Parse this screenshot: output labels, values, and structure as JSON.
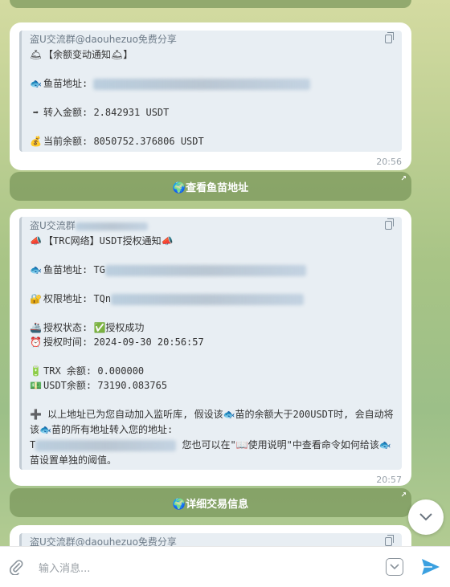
{
  "messages": [
    {
      "header": "盗U交流群@daouhezuo免费分享",
      "lines": [
        {
          "emoji": "🛎",
          "text": "【余额变动通知🛎】"
        },
        {
          "emoji": "🐟",
          "text": "鱼苗地址: "
        },
        {
          "emoji": "➡",
          "text": "转入金额: 2.842931 USDT"
        },
        {
          "emoji": "💰",
          "text": "当前余额: 8050752.376806 USDT"
        }
      ],
      "time": "20:56",
      "button": "🌍查看鱼苗地址"
    },
    {
      "header": "盗U交流群",
      "lines": [
        {
          "emoji": "📣",
          "text": "【TRC网络】USDT授权通知📣"
        },
        {
          "emoji": "🐟",
          "text": "鱼苗地址: TG"
        },
        {
          "emoji": "🔐",
          "text": "权限地址: TQn"
        },
        {
          "emoji": "🚢",
          "text": "授权状态: ✅授权成功"
        },
        {
          "emoji": "⏰",
          "text": "授权时间: 2024-09-30 20:56:57"
        },
        {
          "emoji": "🔋",
          "text": "TRX 余额: 0.000000"
        },
        {
          "emoji": "💵",
          "text": "USDT余额: 73190.083765"
        }
      ],
      "paragraph_a": "➕ 以上地址已为您自动加入监听库, 假设该🐟苗的余额大于200USDT时, 会自动将该🐟苗的所有地址转入您的地址:",
      "paragraph_b_prefix": "T",
      "paragraph_b": "您也可以在\"📖使用说明\"中查看命令如何给该🐟苗设置单独的阈值。",
      "time": "20:57",
      "button": "🌍详细交易信息"
    },
    {
      "header": "盗U交流群@daouhezuo免费分享"
    }
  ],
  "input": {
    "placeholder": "输入消息..."
  }
}
